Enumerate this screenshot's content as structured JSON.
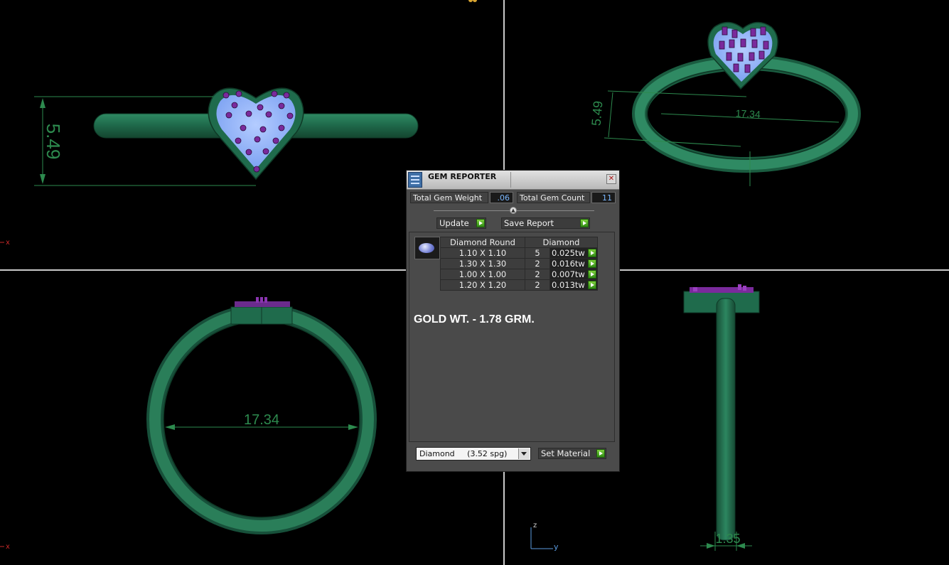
{
  "viewports": {
    "top_left": {
      "dimension": "5.49",
      "axis_label": "x"
    },
    "top_right": {
      "dimension_height": "5.49",
      "dimension_width": "17.34"
    },
    "bottom_left": {
      "dimension": "17.34",
      "axis_label": "x"
    },
    "bottom_right": {
      "dimension": "1.35",
      "axis_z": "z",
      "axis_y": "y"
    }
  },
  "gem_reporter": {
    "title": "GEM REPORTER",
    "close_icon": "close-icon",
    "total_gem_weight_label": "Total Gem Weight",
    "total_gem_weight_value": ".06",
    "total_gem_count_label": "Total Gem Count",
    "total_gem_count_value": "11",
    "update_label": "Update",
    "save_report_label": "Save Report",
    "table": {
      "headers": [
        "Diamond Round",
        "Diamond"
      ],
      "rows": [
        {
          "size": "1.10 X 1.10",
          "count": "5",
          "weight": "0.025tw"
        },
        {
          "size": "1.30 X 1.30",
          "count": "2",
          "weight": "0.016tw"
        },
        {
          "size": "1.00 X 1.00",
          "count": "2",
          "weight": "0.007tw"
        },
        {
          "size": "1.20 X 1.20",
          "count": "2",
          "weight": "0.013tw"
        }
      ]
    },
    "gold_weight_text": "GOLD WT. - 1.78 GRM.",
    "material_value": "Diamond     (3.52 spg)",
    "set_material_label": "Set Material"
  },
  "colors": {
    "background": "#000000",
    "ring_metal": "#1f6b4c",
    "gem_fill": "#8fb4ff",
    "gem_stone": "#8a2fb0",
    "dimension_line": "#2d8a4e",
    "viewport_divider": "#c9c9c9",
    "value_text": "#7bb8ff",
    "go_arrow": "#4caf27"
  }
}
